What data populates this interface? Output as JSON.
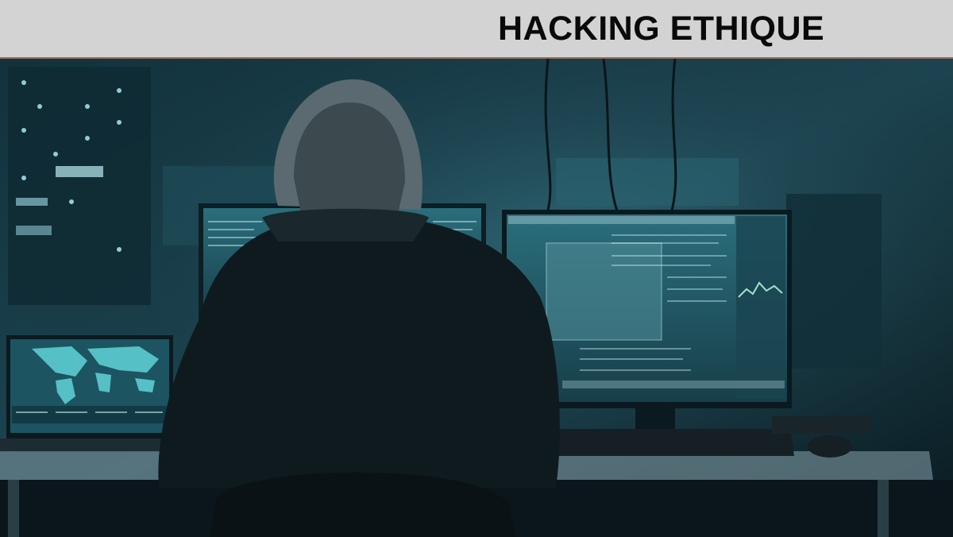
{
  "header": {
    "title": "HACKING ETHIQUE",
    "background": "#d3d3d3"
  },
  "photo": {
    "subject": "hooded-figure-at-computer-desk",
    "palette": {
      "dark": "#0b1a22",
      "teal": "#2f6f7c",
      "screen": "#8fd3e0"
    }
  }
}
